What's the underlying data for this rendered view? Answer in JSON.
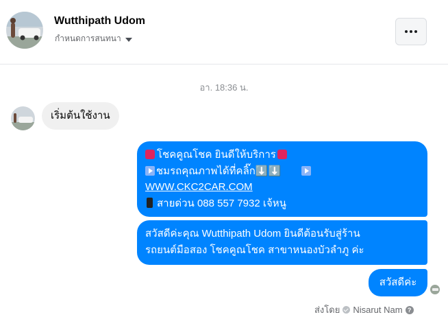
{
  "header": {
    "name": "Wutthipath Udom",
    "subtitle": "กำหนดการสนทนา",
    "more_label": "···"
  },
  "conversation": {
    "timestamp": "อา. 18:36 น.",
    "incoming": [
      {
        "text": "เริ่มต้นใช้งาน"
      }
    ],
    "outgoing": {
      "welcome": {
        "line1": "โชคคูณโชค ยินดีให้บริการ",
        "line2": "ชมรถคุณภาพได้ที่คลิ๊ก⬇️⬇️",
        "link": "WWW.CKC2CAR.COM",
        "hotline": "สายด่วน 088 557 7932 เจ้หนู"
      },
      "greeting": {
        "line1": "สวัสดีค่ะคุณ Wutthipath Udom ยินดีต้อนรับสู่ร้าน",
        "line2": "รถยนต์มือสอง โชคคูณโชค สาขาหนองบัวลำภู ค่ะ"
      },
      "reply": "สวัสดีค่ะ"
    },
    "sent_by_label": "ส่งโดย",
    "sent_by_name": "Nisarut Nam",
    "help_label": "?"
  },
  "colors": {
    "outgoing_bubble": "#0084ff",
    "incoming_bubble": "#f0f0f0",
    "meta_text": "#65676b"
  },
  "icons": [
    "dropdown-caret-icon",
    "more-dots-icon",
    "red-square-emoji-icon",
    "play-emoji-icon",
    "phone-emoji-icon",
    "sent-check-icon",
    "help-icon"
  ]
}
